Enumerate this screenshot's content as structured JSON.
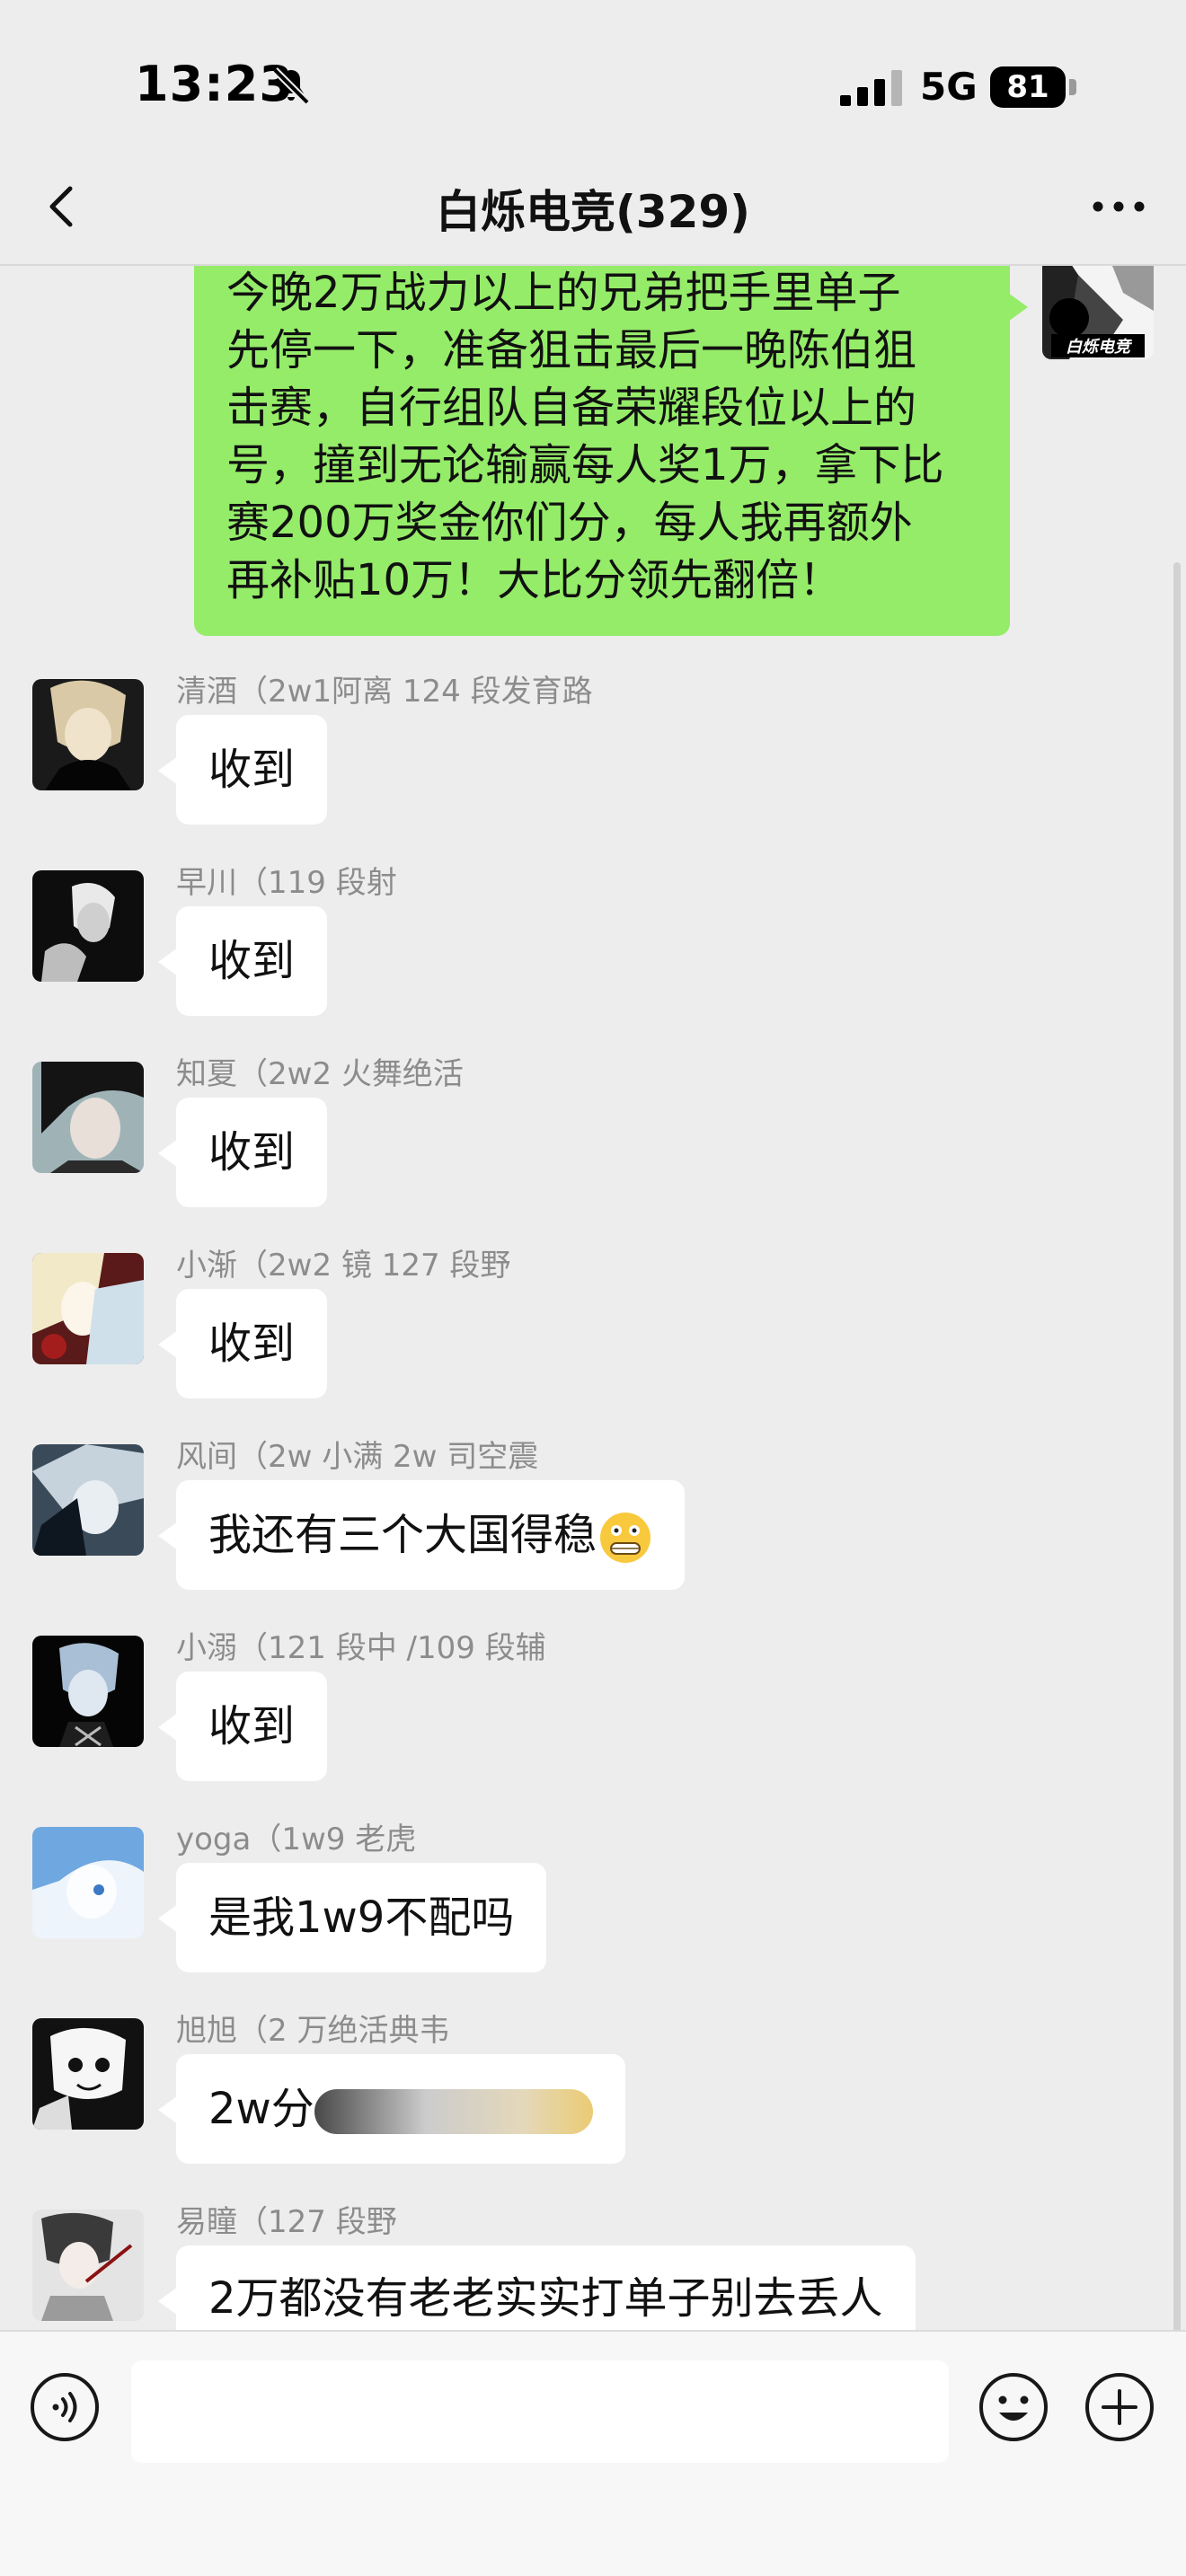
{
  "status_bar": {
    "time": "13:23",
    "network": "5G",
    "battery": "81"
  },
  "nav": {
    "title": "白烁电竞(329)"
  },
  "self_message": {
    "lines": [
      "今晚2万战力以上的兄弟把手里单子",
      "先停一下，准备狙击最后一晚陈伯狙",
      "击赛，自行组队自备荣耀段位以上的",
      "号，撞到无论输赢每人奖1万，拿下比",
      "赛200万奖金你们分，每人我再额外",
      "再补贴10万！大比分领先翻倍！"
    ],
    "avatar_label": "白烁电竞"
  },
  "messages": [
    {
      "sender": "清酒（2w1阿离 124 段发育路",
      "text": "收到"
    },
    {
      "sender": "早川（119 段射",
      "text": "收到"
    },
    {
      "sender": "知夏（2w2 火舞绝活",
      "text": "收到"
    },
    {
      "sender": "小渐（2w2 镜 127 段野",
      "text": "收到"
    },
    {
      "sender": "风间（2w 小满 2w 司空震",
      "text": "我还有三个大国得稳"
    },
    {
      "sender": "小溺（121 段中 /109 段辅",
      "text": "收到"
    },
    {
      "sender": "yoga（1w9 老虎",
      "text": "是我1w9不配吗"
    },
    {
      "sender": "旭旭（2 万绝活典韦",
      "text": "2w分"
    },
    {
      "sender": "易瞳（127 段野",
      "text": "2万都没有老老实实打单子别去丢人"
    }
  ],
  "input": {
    "placeholder": ""
  },
  "colors": {
    "self_bubble": "#95ec69",
    "background": "#ededed",
    "other_bubble": "#ffffff"
  },
  "icons": {
    "mute": "bell-slash-icon",
    "back": "chevron-left-icon",
    "more": "more-dots-icon",
    "voice": "voice-icon",
    "emoji": "emoji-icon",
    "plus": "plus-icon"
  }
}
